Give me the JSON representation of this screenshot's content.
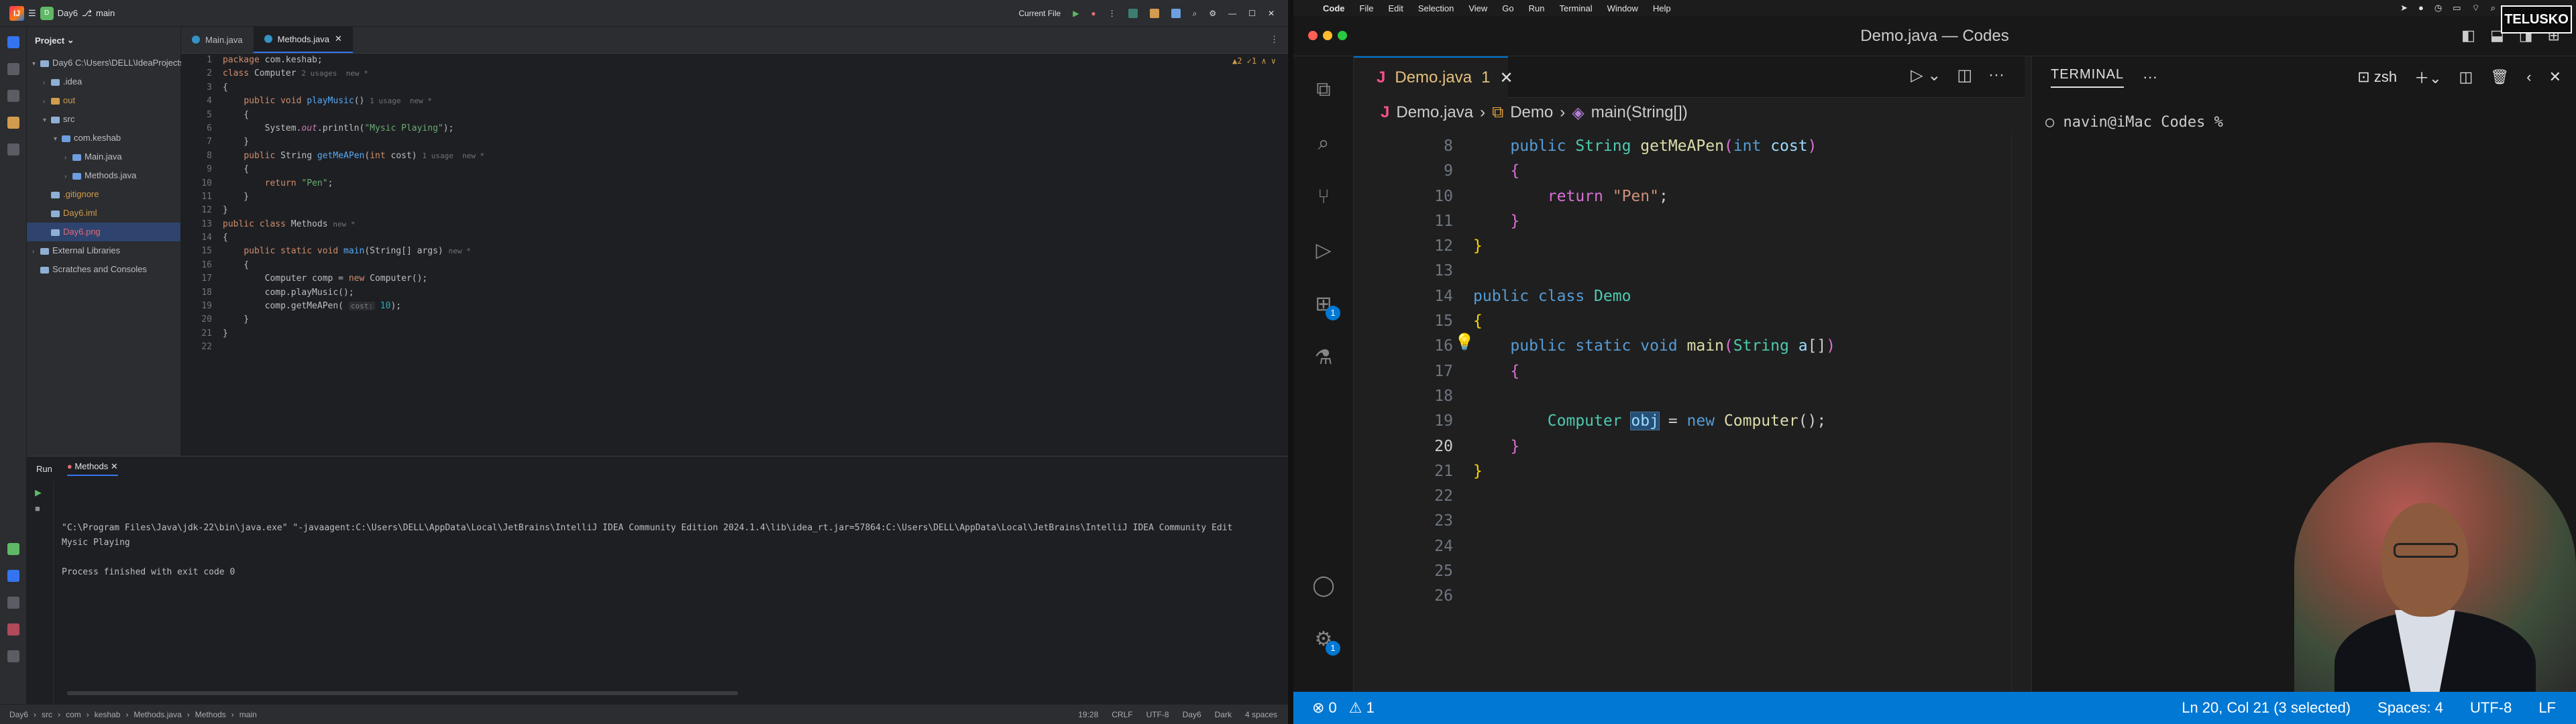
{
  "intellij": {
    "project_name": "Day6",
    "branch": "main",
    "run_config": "Current File",
    "tabs": [
      {
        "label": "Main.java",
        "active": false
      },
      {
        "label": "Methods.java",
        "active": true
      }
    ],
    "project_panel_title": "Project",
    "tree": [
      {
        "label": "Day6  C:\\Users\\DELL\\IdeaProjects\\Day6",
        "indent": 0,
        "arrow": "▾",
        "kind": "folder"
      },
      {
        "label": ".idea",
        "indent": 1,
        "arrow": "›",
        "kind": "folder"
      },
      {
        "label": "out",
        "indent": 1,
        "arrow": "›",
        "kind": "folder-orange"
      },
      {
        "label": "src",
        "indent": 1,
        "arrow": "▾",
        "kind": "folder"
      },
      {
        "label": "com.keshab",
        "indent": 2,
        "arrow": "▾",
        "kind": "package"
      },
      {
        "label": "Main.java",
        "indent": 3,
        "arrow": "›",
        "kind": "java"
      },
      {
        "label": "Methods.java",
        "indent": 3,
        "arrow": "›",
        "kind": "java"
      },
      {
        "label": ".gitignore",
        "indent": 1,
        "arrow": "",
        "kind": "file"
      },
      {
        "label": "Day6.iml",
        "indent": 1,
        "arrow": "",
        "kind": "file"
      },
      {
        "label": "Day6.png",
        "indent": 1,
        "arrow": "",
        "kind": "file-selected"
      },
      {
        "label": "External Libraries",
        "indent": 0,
        "arrow": "›",
        "kind": "lib"
      },
      {
        "label": "Scratches and Consoles",
        "indent": 0,
        "arrow": "",
        "kind": "lib"
      }
    ],
    "inspection": "▲2  ✓1  ∧  ∨",
    "code_lines": [
      {
        "n": "1",
        "html": "<span class='kw'>package</span> com.keshab;"
      },
      {
        "n": "2",
        "html": "<span class='kw'>class</span> Computer <span class='gr'>2 usages  new *</span>"
      },
      {
        "n": "3",
        "html": "{"
      },
      {
        "n": "4",
        "html": "    <span class='kw'>public void</span> <span class='fn'>playMusic</span>() <span class='gr'>1 usage  new *</span>"
      },
      {
        "n": "5",
        "html": "    {"
      },
      {
        "n": "6",
        "html": "        System.<span class='it'>out</span>.println(<span class='st'>\"Mysic Playing\"</span>);"
      },
      {
        "n": "7",
        "html": "    }"
      },
      {
        "n": "8",
        "html": "    <span class='kw'>public</span> String <span class='fn'>getMeAPen</span>(<span class='kw'>int</span> cost) <span class='gr'>1 usage  new *</span>"
      },
      {
        "n": "9",
        "html": "    {"
      },
      {
        "n": "10",
        "html": "        <span class='kw'>return</span> <span class='st'>\"Pen\"</span>;"
      },
      {
        "n": "11",
        "html": "    }"
      },
      {
        "n": "12",
        "html": "}"
      },
      {
        "n": "13",
        "html": "<span class='kw'>public class</span> Methods <span class='gr'>new *</span>"
      },
      {
        "n": "14",
        "html": "{"
      },
      {
        "n": "15",
        "html": "    <span class='kw'>public static void</span> <span class='fn'>main</span>(String[] args) <span class='gr'>new *</span>"
      },
      {
        "n": "16",
        "html": "    {"
      },
      {
        "n": "17",
        "html": "        Computer comp = <span class='kw'>new</span> Computer();"
      },
      {
        "n": "18",
        "html": "        comp.playMusic();"
      },
      {
        "n": "19",
        "html": "        comp.getMeAPen( <span class='param-hint'>cost:</span> <span class='cn'>10</span>);"
      },
      {
        "n": "20",
        "html": "    }"
      },
      {
        "n": "21",
        "html": "}"
      },
      {
        "n": "22",
        "html": ""
      }
    ],
    "run_title": "Run",
    "run_tab": "Methods",
    "console_lines": [
      "\"C:\\Program Files\\Java\\jdk-22\\bin\\java.exe\" \"-javaagent:C:\\Users\\DELL\\AppData\\Local\\JetBrains\\IntelliJ IDEA Community Edition 2024.1.4\\lib\\idea_rt.jar=57864:C:\\Users\\DELL\\AppData\\Local\\JetBrains\\IntelliJ IDEA Community Edit",
      "Mysic Playing",
      "",
      "Process finished with exit code 0"
    ],
    "status_crumbs": [
      "Day6",
      "src",
      "com",
      "keshab",
      "Methods.java",
      "Methods",
      "main"
    ],
    "status_right": [
      "19:28",
      "CRLF",
      "UTF-8",
      "Day6",
      "Dark",
      "4 spaces"
    ]
  },
  "vscode": {
    "menu": [
      "Code",
      "File",
      "Edit",
      "Selection",
      "View",
      "Go",
      "Run",
      "Terminal",
      "Window",
      "Help"
    ],
    "window_title": "Demo.java — Codes",
    "tab_label": "Demo.java",
    "tab_badge": "1",
    "breadcrumb": [
      "Demo.java",
      "Demo",
      "main(String[])"
    ],
    "activity_badges": {
      "extensions": "1",
      "settings": "1"
    },
    "lines": [
      {
        "n": "8",
        "html": "    <span class='vk'>public</span> <span class='vt'>String</span> <span class='vf'>getMeAPen</span><span class='vb2'>(</span><span class='vk'>int</span> <span class='vv'>cost</span><span class='vb2'>)</span>"
      },
      {
        "n": "9",
        "html": "    <span class='vb2'>{</span>"
      },
      {
        "n": "10",
        "html": "        <span class='vb2'>return</span> <span class='vs'>\"Pen\"</span>;"
      },
      {
        "n": "11",
        "html": "    <span class='vb2'>}</span>"
      },
      {
        "n": "12",
        "html": "<span class='vb'>}</span>"
      },
      {
        "n": "13",
        "html": ""
      },
      {
        "n": "14",
        "html": "<span class='vk'>public class</span> <span class='vt'>Demo</span>"
      },
      {
        "n": "15",
        "html": "<span class='vb'>{</span>"
      },
      {
        "n": "16",
        "html": "    <span class='vk'>public static void</span> <span class='vf'>main</span><span class='vb2'>(</span><span class='vt'>String</span> <span class='vv'>a</span>[]<span class='vb2'>)</span>"
      },
      {
        "n": "17",
        "html": "    <span class='vb2'>{</span>"
      },
      {
        "n": "18",
        "html": ""
      },
      {
        "n": "19",
        "html": "        <span class='vt'>Computer</span> <span class='vv selw'>obj</span> = <span class='vk'>new</span> <span class='vf'>Computer</span>();"
      },
      {
        "n": "20",
        "html": "    <span class='vb2'>}</span>"
      },
      {
        "n": "21",
        "html": "<span class='vb'>}</span>"
      },
      {
        "n": "22",
        "html": ""
      },
      {
        "n": "23",
        "html": ""
      },
      {
        "n": "24",
        "html": ""
      },
      {
        "n": "25",
        "html": ""
      },
      {
        "n": "26",
        "html": ""
      }
    ],
    "terminal_tab": "TERMINAL",
    "terminal_shell": "zsh",
    "terminal_prompt": "navin@iMac Codes %",
    "status_left": {
      "errors": "⊗ 0",
      "warnings": "⚠ 1"
    },
    "status_right": [
      "Ln 20, Col 21 (3 selected)",
      "Spaces: 4",
      "UTF-8",
      "LF"
    ]
  },
  "overlay": {
    "channel_badge": "TELUSKO"
  },
  "colors": {
    "vs_status": "#0078d4",
    "ij_accent": "#3574f0"
  }
}
